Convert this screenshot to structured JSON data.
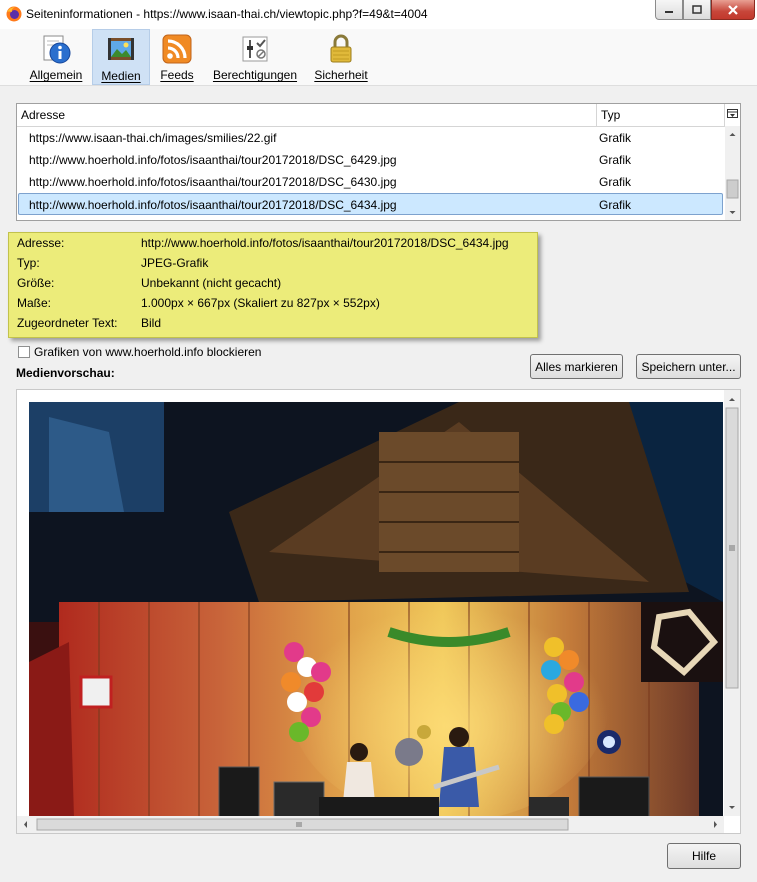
{
  "window": {
    "title": "Seiteninformationen - https://www.isaan-thai.ch/viewtopic.php?f=49&t=4004"
  },
  "tabs": [
    {
      "label": "Allgemein",
      "icon": "info-icon"
    },
    {
      "label": "Medien",
      "icon": "media-icon",
      "selected": true
    },
    {
      "label": "Feeds",
      "icon": "rss-feed-icon"
    },
    {
      "label": "Berechtigungen",
      "icon": "permissions-sliders-icon"
    },
    {
      "label": "Sicherheit",
      "icon": "padlock-icon"
    }
  ],
  "media_list": {
    "columns": {
      "address": "Adresse",
      "type": "Typ"
    },
    "rows": [
      {
        "address": "https://www.isaan-thai.ch/images/smilies/22.gif",
        "type": "Grafik"
      },
      {
        "address": "http://www.hoerhold.info/fotos/isaanthai/tour20172018/DSC_6429.jpg",
        "type": "Grafik"
      },
      {
        "address": "http://www.hoerhold.info/fotos/isaanthai/tour20172018/DSC_6430.jpg",
        "type": "Grafik"
      },
      {
        "address": "http://www.hoerhold.info/fotos/isaanthai/tour20172018/DSC_6434.jpg",
        "type": "Grafik",
        "selected": true
      }
    ]
  },
  "info": {
    "rows": [
      {
        "label": "Adresse:",
        "value": "http://www.hoerhold.info/fotos/isaanthai/tour20172018/DSC_6434.jpg"
      },
      {
        "label": "Typ:",
        "value": "JPEG-Grafik"
      },
      {
        "label": "Größe:",
        "value": "Unbekannt (nicht gecacht)"
      },
      {
        "label": "Maße:",
        "value": "1.000px × 667px (Skaliert zu 827px × 552px)"
      },
      {
        "label": "Zugeordneter Text:",
        "value": "Bild"
      }
    ]
  },
  "block_checkbox": {
    "label": "Grafiken von www.hoerhold.info blockieren",
    "checked": false
  },
  "preview": {
    "label": "Medienvorschau:"
  },
  "buttons": {
    "select_all": "Alles markieren",
    "save_as": "Speichern unter...",
    "help": "Hilfe"
  },
  "colors": {
    "selected_row": "#cce8ff",
    "info_bg": "#ecec7a",
    "tab_selected": "#cfe1f5"
  }
}
